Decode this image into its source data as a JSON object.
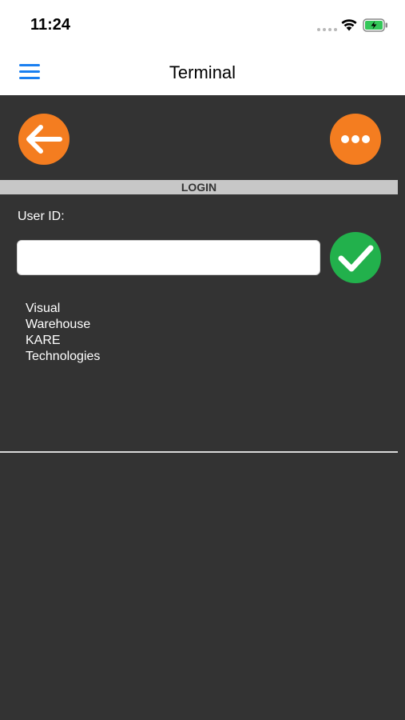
{
  "status_bar": {
    "time": "11:24",
    "icons": [
      "cellular-dots-icon",
      "wifi-icon",
      "battery-charging-icon"
    ]
  },
  "nav": {
    "title": "Terminal",
    "menu_icon": "hamburger-menu-icon"
  },
  "toolbar": {
    "back_icon": "arrow-left-icon",
    "more_icon": "ellipsis-icon"
  },
  "login": {
    "section_title": "LOGIN",
    "user_id_label": "User ID:",
    "user_id_value": "",
    "confirm_icon": "checkmark-icon"
  },
  "company_info": {
    "lines": [
      "Visual",
      "Warehouse",
      "KARE",
      "Technologies"
    ]
  },
  "colors": {
    "accent_orange": "#f47d20",
    "confirm_green": "#22b14c",
    "nav_blue": "#1a7ff0",
    "background": "#333333",
    "section_bar": "#c7c7c7"
  }
}
